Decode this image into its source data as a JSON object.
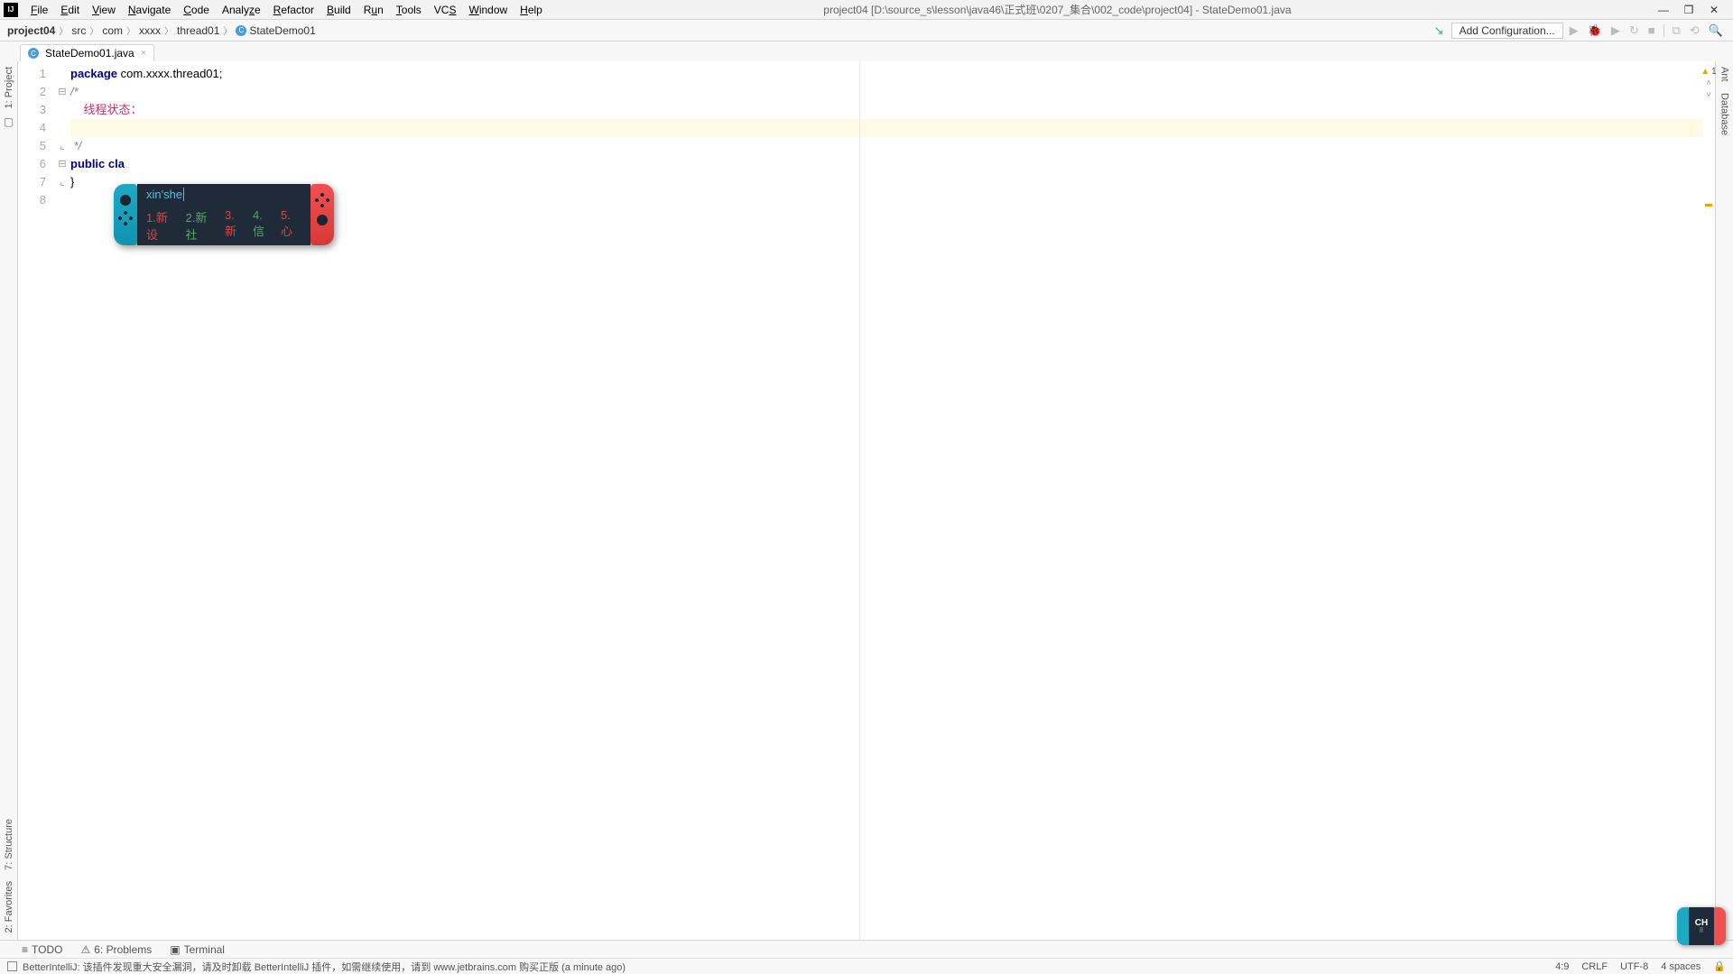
{
  "window": {
    "title": "project04 [D:\\source_s\\lesson\\java46\\正式班\\0207_集合\\002_code\\project04] - StateDemo01.java"
  },
  "menu": [
    "File",
    "Edit",
    "View",
    "Navigate",
    "Code",
    "Analyze",
    "Refactor",
    "Build",
    "Run",
    "Tools",
    "VCS",
    "Window",
    "Help"
  ],
  "menu_underline_idx": [
    0,
    0,
    0,
    0,
    0,
    3,
    0,
    0,
    1,
    0,
    2,
    0,
    0
  ],
  "breadcrumbs": [
    "project04",
    "src",
    "com",
    "xxxx",
    "thread01",
    "StateDemo01"
  ],
  "add_config": "Add Configuration...",
  "tab": {
    "name": "StateDemo01.java"
  },
  "left_tools": {
    "project": "1: Project",
    "structure": "7: Structure",
    "favorites": "2: Favorites"
  },
  "right_tools": {
    "ant": "Ant",
    "database": "Database"
  },
  "annotator": {
    "warn_count": "1"
  },
  "code": {
    "l1a": "package",
    "l1b": " com.xxxx.thread01;",
    "l2": "/*",
    "l3": "    线程状态：",
    "l4": "",
    "l5": " */",
    "l6a": "public ",
    "l6b": "cla",
    "l7": "}",
    "gutter": [
      "1",
      "2",
      "3",
      "4",
      "5",
      "6",
      "7",
      "8"
    ]
  },
  "ime": {
    "input": "xin'she",
    "candidates": [
      {
        "n": "1.",
        "t": "新设"
      },
      {
        "n": "2.",
        "t": "新社"
      },
      {
        "n": "3.",
        "t": "新"
      },
      {
        "n": "4.",
        "t": "信"
      },
      {
        "n": "5.",
        "t": "心"
      }
    ]
  },
  "bottom": {
    "todo": "TODO",
    "problems": "6: Problems",
    "terminal": "Terminal"
  },
  "status": {
    "left": "BetterIntelliJ: 该插件发现重大安全漏洞，请及时卸载 BetterIntelliJ 插件，如需继续使用，请到 www.jetbrains.com 购买正版 (a minute ago)",
    "pos": "4:9",
    "eol": "CRLF",
    "enc": "UTF-8",
    "spaces": "4 spaces"
  },
  "ch_float": "CH"
}
